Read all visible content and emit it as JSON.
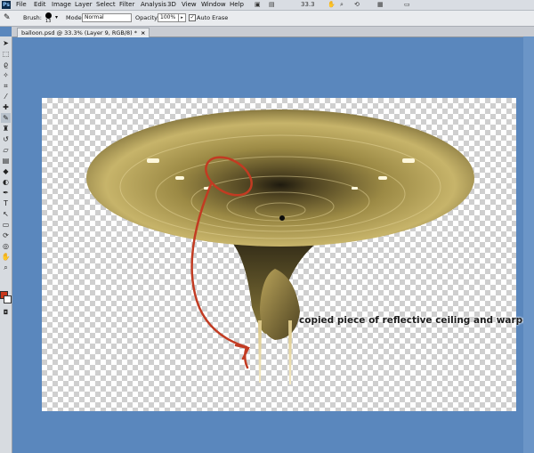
{
  "menu": [
    "File",
    "Edit",
    "Image",
    "Layer",
    "Select",
    "Filter",
    "Analysis",
    "3D",
    "View",
    "Window",
    "Help"
  ],
  "app_logo": "Ps",
  "zoom_display": "33.3",
  "options": {
    "brush_label": "Brush:",
    "brush_size": "13",
    "mode_label": "Mode:",
    "mode_value": "Normal",
    "opacity_label": "Opacity:",
    "opacity_value": "100%",
    "auto_erase_label": "Auto Erase"
  },
  "document_tab": {
    "title": "balloon.psd @ 33.3% (Layer 9, RGB/8) *",
    "close": "×"
  },
  "annotation": "copied piece of reflective ceiling and warped",
  "colors": {
    "foreground": "#c8381c",
    "background": "#ffffff",
    "annotation_arrow": "#c23b22"
  }
}
